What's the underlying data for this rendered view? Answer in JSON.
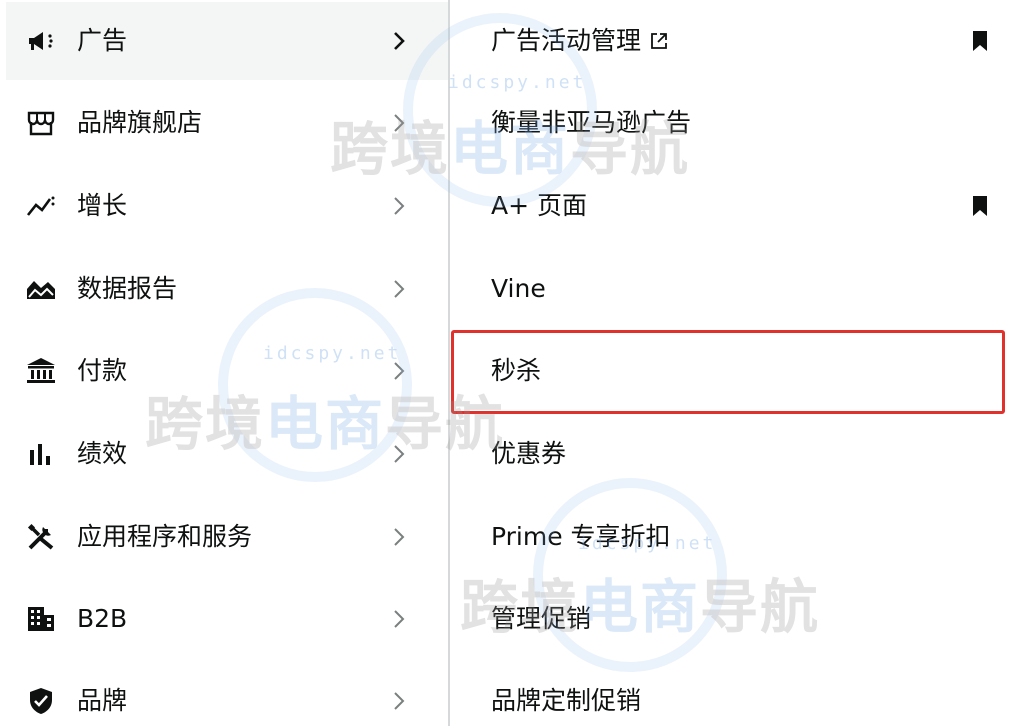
{
  "left_menu": {
    "items": [
      {
        "label": "广告",
        "icon": "megaphone-icon",
        "active": true
      },
      {
        "label": "品牌旗舰店",
        "icon": "storefront-icon"
      },
      {
        "label": "增长",
        "icon": "growth-chart-icon"
      },
      {
        "label": "数据报告",
        "icon": "report-mountain-icon"
      },
      {
        "label": "付款",
        "icon": "bank-icon"
      },
      {
        "label": "绩效",
        "icon": "bar-chart-icon"
      },
      {
        "label": "应用程序和服务",
        "icon": "tools-icon"
      },
      {
        "label": "B2B",
        "icon": "building-icon"
      },
      {
        "label": "品牌",
        "icon": "shield-icon"
      }
    ]
  },
  "submenu": {
    "items": [
      {
        "label": "广告活动管理",
        "external": true,
        "bookmarked": true
      },
      {
        "label": "衡量非亚马逊广告",
        "bookmarked": false
      },
      {
        "label": "A+ 页面",
        "bookmarked": true
      },
      {
        "label": "Vine",
        "bookmarked": false
      },
      {
        "label": "秒杀",
        "highlighted": true
      },
      {
        "label": "优惠券"
      },
      {
        "label": "Prime 专享折扣"
      },
      {
        "label": "管理促销"
      },
      {
        "label": "品牌定制促销"
      }
    ]
  },
  "watermark": {
    "url": "idcspy.net",
    "text_gray": "跨境",
    "text_blue": "电商",
    "text_gray2": "导航"
  },
  "colors": {
    "highlight": "#e0312c",
    "active_bg": "#f4f6f6",
    "text": "#0f1111",
    "divider": "#d5d9d9"
  }
}
